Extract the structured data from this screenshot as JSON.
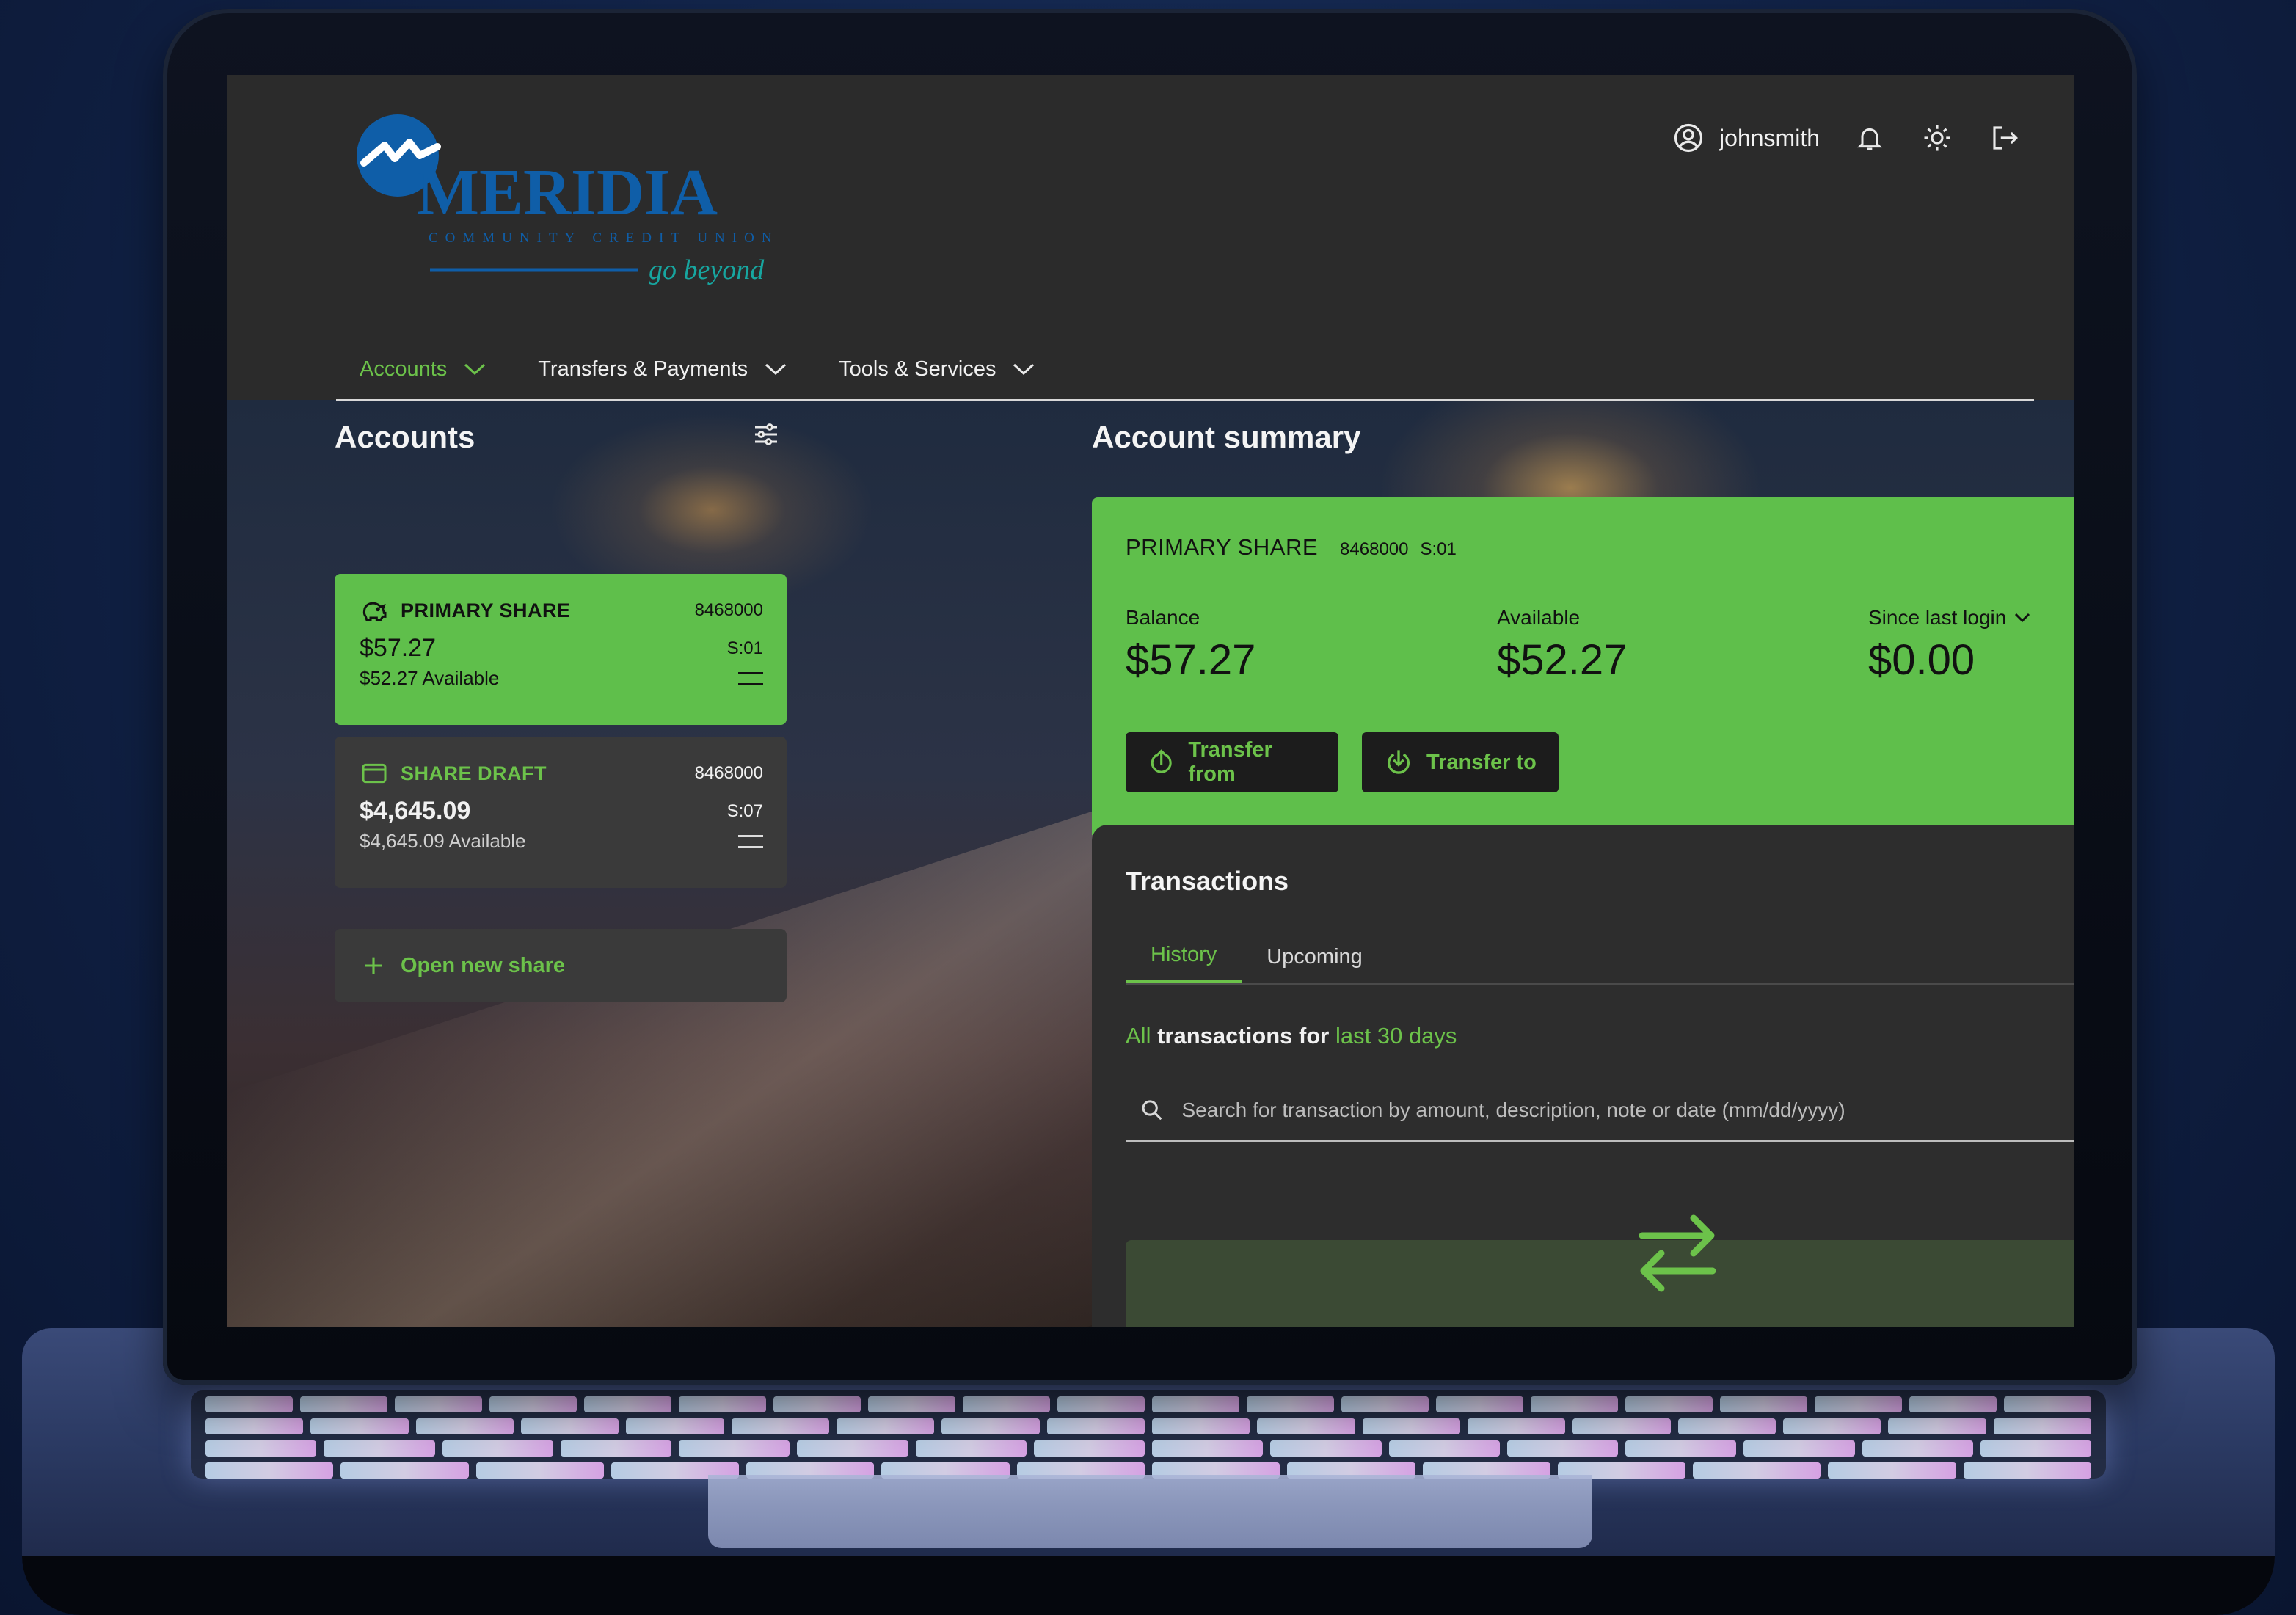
{
  "brand": {
    "name": "MERIDIA",
    "subtitle": "COMMUNITY CREDIT UNION",
    "tagline": "go beyond",
    "colors": {
      "accent": "#6cc24a",
      "logo_blue": "#0f5ea8",
      "logo_teal": "#17a6a0"
    }
  },
  "user": {
    "username": "johnsmith"
  },
  "header_icons": [
    "user-circle-icon",
    "bell-icon",
    "sun-icon",
    "logout-icon"
  ],
  "nav": {
    "items": [
      {
        "label": "Accounts",
        "active": true
      },
      {
        "label": "Transfers & Payments",
        "active": false
      },
      {
        "label": "Tools & Services",
        "active": false
      }
    ]
  },
  "accounts_panel": {
    "title": "Accounts",
    "accounts": [
      {
        "name": "PRIMARY SHARE",
        "number": "8468000",
        "balance": "$57.27",
        "suffix": "S:01",
        "available": "$52.27 Available",
        "icon": "piggy-bank-icon",
        "selected": true
      },
      {
        "name": "SHARE DRAFT",
        "number": "8468000",
        "balance": "$4,645.09",
        "suffix": "S:07",
        "available": "$4,645.09 Available",
        "icon": "wallet-icon",
        "selected": false
      }
    ],
    "open_new_label": "Open new share"
  },
  "summary": {
    "title": "Account summary",
    "account_name": "PRIMARY SHARE",
    "account_number": "8468000",
    "account_suffix": "S:01",
    "balance_label": "Balance",
    "balance_value": "$57.27",
    "available_label": "Available",
    "available_value": "$52.27",
    "since_label": "Since last login",
    "since_value": "$0.00",
    "transfer_from_label": "Transfer from",
    "transfer_to_label": "Transfer to"
  },
  "transactions": {
    "title": "Transactions",
    "tabs": [
      {
        "label": "History",
        "active": true
      },
      {
        "label": "Upcoming",
        "active": false
      }
    ],
    "filter_all": "All",
    "filter_mid": "transactions for",
    "filter_range": "last 30 days",
    "search_placeholder": "Search for transaction by amount, description, note or date (mm/dd/yyyy)"
  }
}
